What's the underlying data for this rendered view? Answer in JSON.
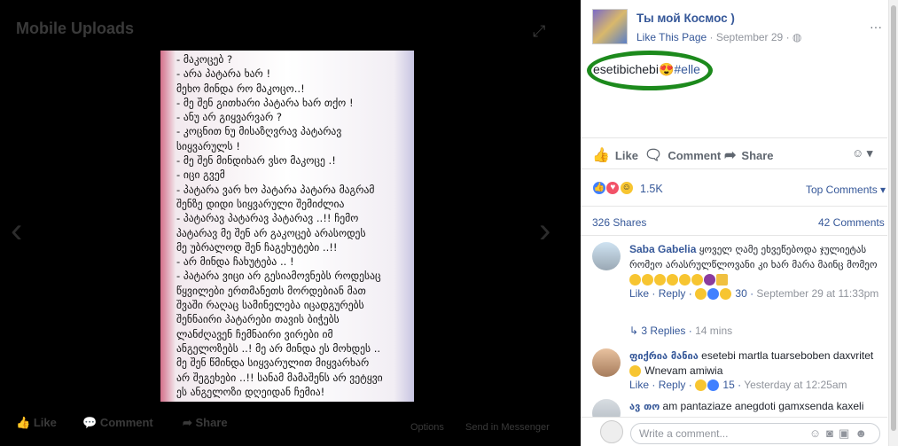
{
  "photo_viewer": {
    "album_title": "Mobile Uploads",
    "photo_lines": [
      "- მაკოცებ ?",
      "- არა პატარა ხარ !",
      "მეხო მინდა რო მაკოცო..!",
      "- მე შენ გითხარი პატარა ხარ თქო !",
      "- ანუ არ გიყვარვარ ?",
      "- კოცნით ნუ მისაზღვრავ პატარავ",
      "სიყვარულს !",
      "- მე შენ მინდიხარ ვსო მაკოცე .!",
      "- იცი გვემ",
      "- პატარა ვარ ხო პატარა პატარა მაგრამ",
      "შენზე დიდი სიყვარული შემიძლია",
      "- პატარავ პატარავ პატარავ ..!! ჩემო",
      "პატარავ მე შენ არ გაკოცებ არასოდეს",
      "მე უბრალოდ შენ ჩაგეხუტები ..!!",
      "- არ მინდა ჩახუტება .. !",
      "- პატარა ვიცი არ გესიამოვნებს როდესაც",
      "წყვილები ერთმანეთს მორდებიან მათ",
      "შვაში რაღაც სამინელება იცადგურებს",
      "შენნაირი პატარები თავის ბიჭებს",
      "ლანძღავენ ჩემნაირი ვირები იმ",
      "ანგელოზებს ..! მე არ მინდა ეს მოხდეს ..",
      "მე შენ წმინდა სიყვარულით მიყვარხარ",
      "არ შეგეხები ..!! სანამ მამაშენს არ ვეტყვი",
      "ეს ანგელოზი დღეიდან ჩემია!"
    ],
    "bottom_like": "Like",
    "bottom_comment": "Comment",
    "bottom_share": "Share",
    "bottom_options": "Options",
    "bottom_send": "Send in Messenger"
  },
  "post": {
    "page_name": "Ты мой Космос )",
    "like_page": "Like This Page",
    "date": "September 29",
    "meta_separator": " · ",
    "text_main": "esetibichebi",
    "text_tag": "#elle",
    "action_like": "Like",
    "action_comment": "Comment",
    "action_share": "Share",
    "reaction_count": "1.5K",
    "top_comments": "Top Comments",
    "shares": "326 Shares",
    "comments_count": "42 Comments"
  },
  "comments": [
    {
      "author": "Saba Gabelia",
      "text": "ყოველ ღამე ეხვეწებოდა ჯულიეტას რომეო არასრულწლოვანი კი ხარ მარა მაინც მომეო",
      "like": "Like",
      "reply": "Reply",
      "reaction_count": "30",
      "time": "September 29 at 11:33pm"
    },
    {
      "author": "ფიქრია მანია",
      "text": "esetebi martla tuarseboben daxvritet",
      "text2": "Wnevam amiwia",
      "like": "Like",
      "reply": "Reply",
      "reaction_count": "15",
      "time": "Yesterday at 12:25am"
    },
    {
      "author": "ავ თო",
      "text": "am pantaziaze anegdoti gamxsenda kaxeli"
    }
  ],
  "replies": {
    "label": "3 Replies",
    "time": "14 mins"
  },
  "write_comment": {
    "placeholder": "Write a comment..."
  },
  "colors": {
    "link": "#365899",
    "highlight_circle": "#1c8a1c"
  }
}
